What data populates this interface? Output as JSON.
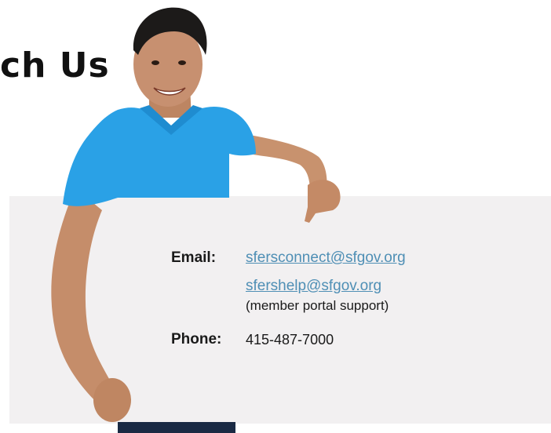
{
  "header": {
    "title": "ch Us"
  },
  "contact": {
    "email_label": "Email:",
    "email_primary": "sfersconnect@sfgov.org",
    "email_secondary": "sfershelp@sfgov.org",
    "email_secondary_note": "(member portal support)",
    "phone_label": "Phone:",
    "phone_value": "415-487-7000"
  },
  "colors": {
    "link": "#4f8fb5",
    "shirt": "#2aa1e6",
    "card": "#f2f0f1"
  }
}
